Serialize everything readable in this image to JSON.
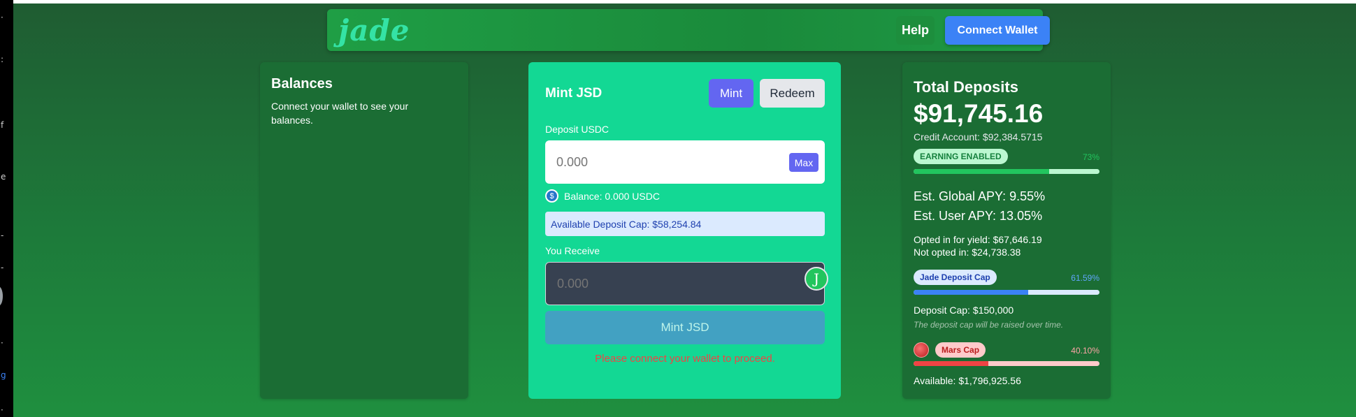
{
  "app": {
    "logo": "jade"
  },
  "navbar": {
    "help_label": "Help",
    "connect_label": "Connect Wallet"
  },
  "balances": {
    "title": "Balances",
    "message": "Connect your wallet to see your balances."
  },
  "mint": {
    "title": "Mint JSD",
    "tab_mint": "Mint",
    "tab_redeem": "Redeem",
    "deposit_label": "Deposit USDC",
    "deposit_placeholder": "0.000",
    "max_label": "Max",
    "usdc_icon_glyph": "$",
    "balance_text": "Balance: 0.000 USDC",
    "cap_text": "Available Deposit Cap: $58,254.84",
    "receive_label": "You Receive",
    "receive_placeholder": "0.000",
    "jsd_icon_glyph": "J",
    "action_label": "Mint JSD",
    "warning": "Please connect your wallet to proceed."
  },
  "deposits": {
    "title": "Total Deposits",
    "amount": "$91,745.16",
    "credit": "Credit Account: $92,384.5715",
    "earning_badge": "EARNING ENABLED",
    "earning_pct": "73%",
    "earning_fill": 0.73,
    "global_apy": "Est. Global APY: 9.55%",
    "user_apy": "Est. User APY: 13.05%",
    "opted_in": "Opted in for yield: $67,646.19",
    "not_opted": "Not opted in: $24,738.38",
    "jade_cap_badge": "Jade Deposit Cap",
    "jade_cap_pct": "61.59%",
    "jade_cap_fill": 0.6159,
    "deposit_cap": "Deposit Cap: $150,000",
    "cap_note": "The deposit cap will be raised over time.",
    "mars_badge": "Mars Cap",
    "mars_pct": "40.10%",
    "mars_fill": 0.401,
    "available": "Available: $1,796,925.56"
  },
  "colors": {
    "accent": "#13d894",
    "primary_button": "#6366f1",
    "wallet_button": "#3b82f6",
    "warning": "#ef4444"
  }
}
